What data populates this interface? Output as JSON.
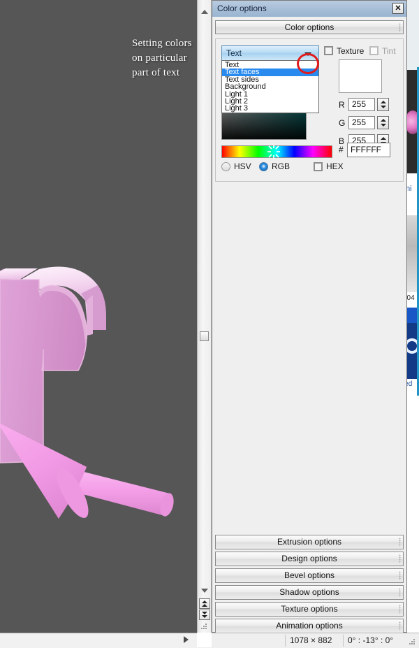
{
  "window": {
    "title": "Color options",
    "close_label": "✕",
    "header_button": "Color options"
  },
  "canvas": {
    "annotation_line1": "Setting colors",
    "annotation_line2": "on particular",
    "annotation_line3": "part of text",
    "background_color": "#565656",
    "object_color": "#e79fe0"
  },
  "color_panel": {
    "target_combo": {
      "selected": "Text",
      "options": [
        "Text",
        "Text faces",
        "Text sides",
        "Background",
        "Light 1",
        "Light 2",
        "Light 3"
      ],
      "highlighted_option": "Text faces",
      "annotation": "red-circle-highlight"
    },
    "texture_checkbox": {
      "label": "Texture",
      "checked": false,
      "enabled": true
    },
    "tint_checkbox": {
      "label": "Tint",
      "checked": false,
      "enabled": false
    },
    "swatch_color": "#FFFFFF",
    "channels": [
      {
        "label": "R",
        "value": "255"
      },
      {
        "label": "G",
        "value": "255"
      },
      {
        "label": "B",
        "value": "255"
      }
    ],
    "hex": {
      "prefix": "#",
      "value": "FFFFFF"
    },
    "mode_radios": [
      {
        "label": "HSV",
        "selected": false
      },
      {
        "label": "RGB",
        "selected": true
      }
    ],
    "hex_checkbox": {
      "label": "HEX",
      "checked": false
    }
  },
  "option_buttons": [
    "Extrusion options",
    "Design options",
    "Bevel options",
    "Shadow options",
    "Texture options",
    "Animation options"
  ],
  "statusbar": {
    "dimensions": "1078 × 882",
    "rotation": "0° : -13° : 0°"
  }
}
